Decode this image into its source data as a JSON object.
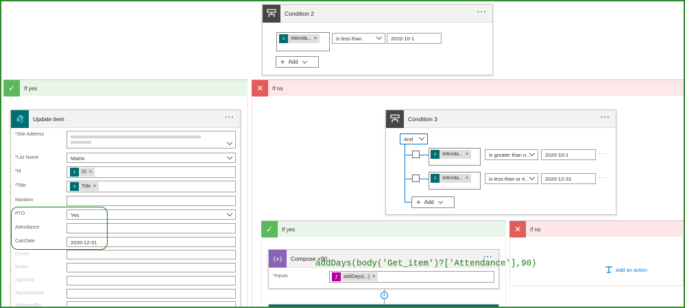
{
  "condition2": {
    "title": "Condition 2",
    "token": "Attenda...",
    "operator": "is less than",
    "value": "2020-10-1",
    "add_label": "Add"
  },
  "if_yes_left": {
    "title": "If yes"
  },
  "if_no_right": {
    "title": "If no"
  },
  "update_item": {
    "title": "Update item",
    "fields": {
      "site_address": {
        "label": "Site Address",
        "value": "SharePoint site address (redacted)"
      },
      "list_name": {
        "label": "List Name",
        "value": "Matrix"
      },
      "id": {
        "label": "Id",
        "token": "ID"
      },
      "title": {
        "label": "Title",
        "token": "Title"
      },
      "random": {
        "label": "Random"
      },
      "pto": {
        "label": "PTO",
        "value": "Yes"
      },
      "attendance": {
        "label": "Attendance"
      },
      "calcdate": {
        "label": "CalcDate",
        "value": "2020-12-31"
      },
      "faint1": {
        "label": "Comm"
      },
      "faint2": {
        "label": "Button"
      },
      "faint3": {
        "label": "Approval"
      },
      "faint4": {
        "label": "ApprovalDate"
      },
      "faint5": {
        "label": "ApprovedBy"
      }
    }
  },
  "condition3": {
    "title": "Condition 3",
    "group_op": "And",
    "rows": [
      {
        "token": "Attenda...",
        "operator": "is greater than o...",
        "value": "2020-10-1"
      },
      {
        "token": "Attenda...",
        "operator": "is less than or e...",
        "value": "2020-12-31"
      }
    ],
    "add_label": "Add"
  },
  "inner_if_yes": {
    "title": "If yes"
  },
  "inner_if_no": {
    "title": "If no",
    "add_action_label": "Add an action"
  },
  "compose": {
    "title": "Compose +90",
    "inputs_label": "Inputs",
    "token": "addDays(...)"
  },
  "annotation": {
    "expression": "addDays(body('Get_item')?['Attendance'],90)"
  },
  "icons": {
    "condition": "condition-icon",
    "sharepoint": "sharepoint-icon",
    "compose": "compose-icon",
    "check": "check-icon",
    "close": "close-icon",
    "add_action": "add-action-icon"
  },
  "colors": {
    "accent": "#0078d4",
    "sharepoint": "#036c70",
    "compose": "#8764b8",
    "expression": "#b4009e",
    "yes": "#5cb85c",
    "no": "#e35b5b",
    "annotation": "#107c10"
  }
}
